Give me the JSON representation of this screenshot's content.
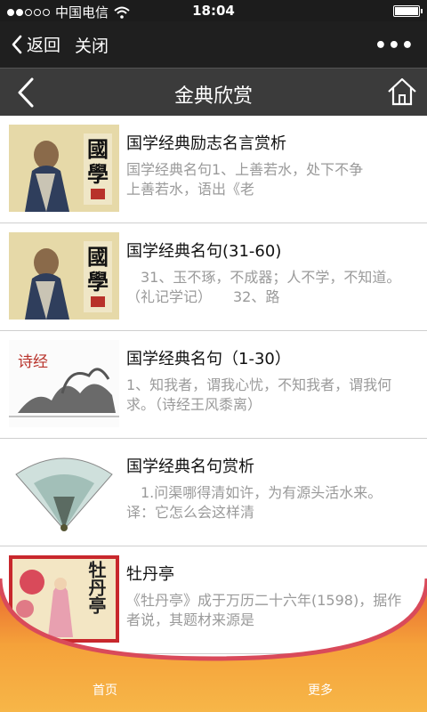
{
  "status": {
    "carrier": "中国电信",
    "time": "18:04"
  },
  "nav": {
    "back": "返回",
    "close": "关闭",
    "more": "•••"
  },
  "title": "金典欣赏",
  "items": [
    {
      "title": "国学经典励志名言赏析",
      "desc": "国学经典名句1、上善若水，处下不争　　上善若水，语出《老"
    },
    {
      "title": "国学经典名句(31-60)",
      "desc": "　31、玉不琢，不成器；人不学，不知道。（礼记学记）　　32、路"
    },
    {
      "title": "国学经典名句（1-30）",
      "desc": "1、知我者，谓我心忧，不知我者，谓我何求。（诗经王风黍离）"
    },
    {
      "title": "国学经典名句赏析",
      "desc": "　1.问渠哪得清如许，为有源头活水来。　　译：它怎么会这样清"
    },
    {
      "title": "牡丹亭",
      "desc": "《牡丹亭》成于万历二十六年(1598)，据作者说，其题材来源是"
    }
  ],
  "thumb_text": {
    "guoxue_1": "國",
    "guoxue_2": "學",
    "shijing": "诗经",
    "mudan": "牡丹亭"
  },
  "tabs": {
    "home": "首页",
    "more": "更多"
  },
  "colors": {
    "accent": "#f5a23a",
    "accent_dark": "#e8632f",
    "navbar": "#1f1f1f",
    "titlebar": "#3b3b3b"
  }
}
